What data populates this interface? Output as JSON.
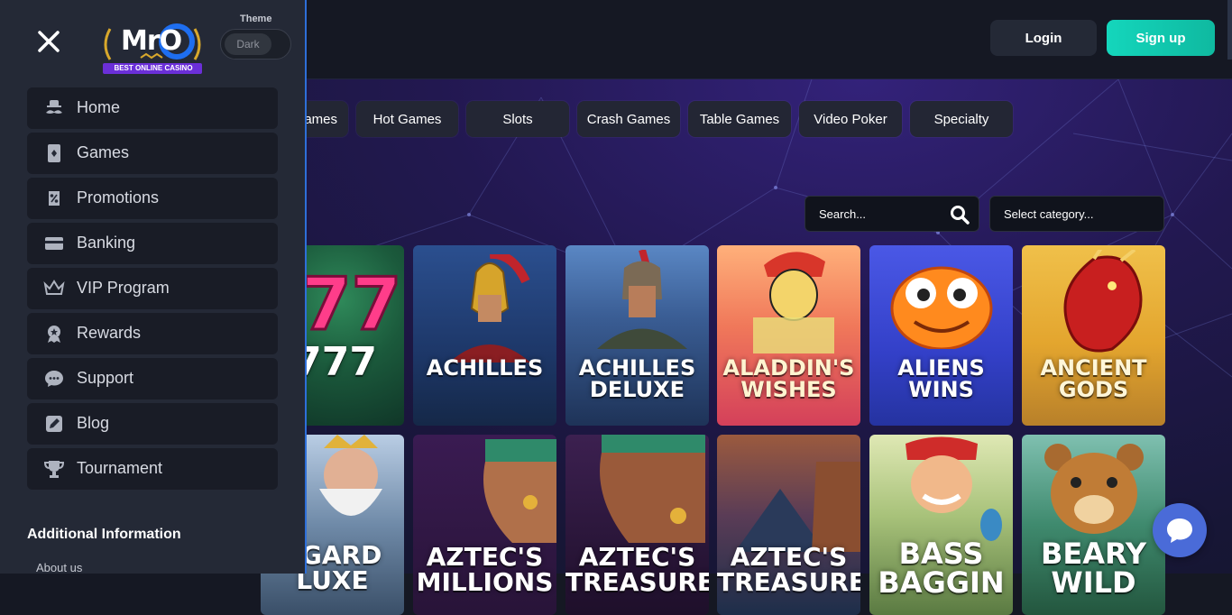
{
  "header": {
    "login_label": "Login",
    "signup_label": "Sign up"
  },
  "sidebar": {
    "logo_text": "MrO",
    "logo_tagline": "BEST ONLINE CASINO",
    "theme_label": "Theme",
    "theme_value": "Dark",
    "items": [
      {
        "label": "Home",
        "icon": "mustache-hat-icon"
      },
      {
        "label": "Games",
        "icon": "playing-card-icon"
      },
      {
        "label": "Promotions",
        "icon": "tag-percent-icon"
      },
      {
        "label": "Banking",
        "icon": "card-icon"
      },
      {
        "label": "VIP Program",
        "icon": "crown-icon"
      },
      {
        "label": "Rewards",
        "icon": "medal-icon"
      },
      {
        "label": "Support",
        "icon": "chat-bubble-icon"
      },
      {
        "label": "Blog",
        "icon": "edit-icon"
      },
      {
        "label": "Tournament",
        "icon": "trophy-icon"
      }
    ],
    "additional_heading": "Additional Information",
    "about_link": "About us"
  },
  "categories": [
    "ames",
    "Hot Games",
    "Slots",
    "Crash Games",
    "Table Games",
    "Video Poker",
    "Specialty"
  ],
  "search": {
    "placeholder": "Search...",
    "category_placeholder": "Select category..."
  },
  "games_row1": [
    {
      "title": "777"
    },
    {
      "title": "ACHILLES"
    },
    {
      "title": "ACHILLES DELUXE"
    },
    {
      "title": "ALADDIN'S WISHES"
    },
    {
      "title": "ALIENS WINS"
    },
    {
      "title": "ANCIENT GODS"
    }
  ],
  "games_row2": [
    {
      "title": "SGARD LUXE"
    },
    {
      "title": "AZTEC'S MILLIONS"
    },
    {
      "title": "AZTEC'S TREASURE"
    },
    {
      "title": "AZTEC'S TREASURE"
    },
    {
      "title": "BASS BAGGIN"
    },
    {
      "title": "BEARY WILD"
    }
  ],
  "colors": {
    "sidebar_bg": "#242936",
    "nav_item_bg": "#191c26",
    "signup_accent": "#14d6bc",
    "chat_button": "#4a6bd8",
    "sidebar_edge": "#2e6fd8"
  }
}
